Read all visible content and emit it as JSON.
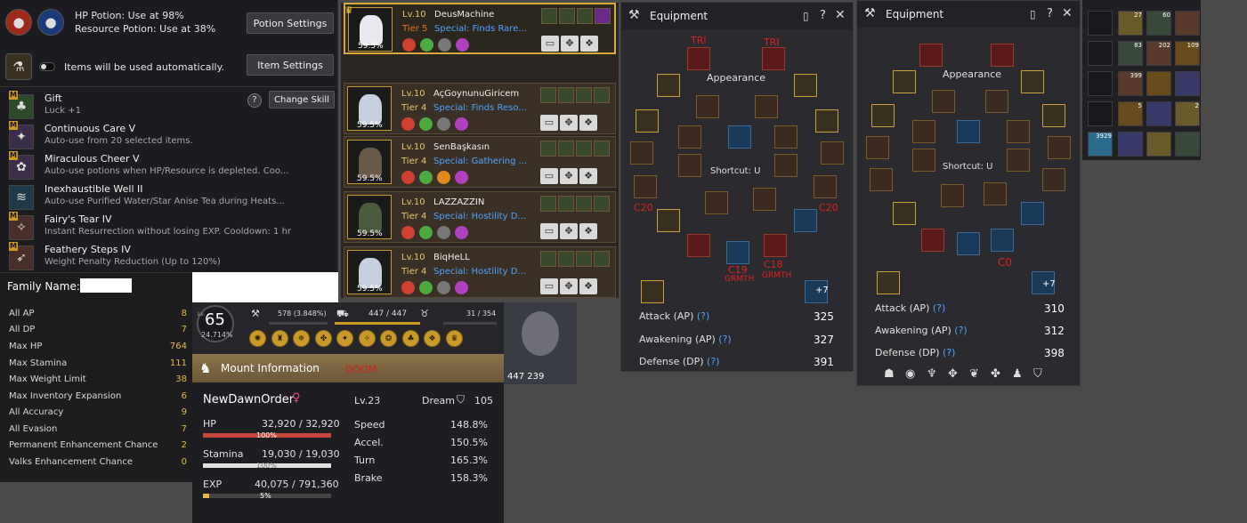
{
  "potions": {
    "hp_text": "HP Potion: Use at 98%",
    "resource_text": "Resource Potion: Use at 38%",
    "potion_settings": "Potion Settings",
    "auto_text": "Items will be used automatically.",
    "item_settings": "Item Settings",
    "change_skill": "Change Skill",
    "help": "?"
  },
  "skills": [
    {
      "name": "Gift",
      "desc": "Luck +1",
      "icon": "clover-icon"
    },
    {
      "name": "Continuous Care V",
      "desc": "Auto-use from 20 selected items.",
      "icon": "care-icon"
    },
    {
      "name": "Miraculous Cheer V",
      "desc": "Auto-use potions when HP/Resource is depleted. Coo...",
      "icon": "cheer-icon"
    },
    {
      "name": "Inexhaustible Well II",
      "desc": "Auto-use Purified Water/Star Anise Tea during Heats...",
      "icon": "well-icon"
    },
    {
      "name": "Fairy's Tear IV",
      "desc": "Instant Resurrection without losing EXP. Cooldown: 1 hr",
      "icon": "tear-icon"
    },
    {
      "name": "Feathery Steps IV",
      "desc": "Weight Penalty Reduction (Up to 120%)",
      "icon": "feather-icon"
    }
  ],
  "family": {
    "title": "Family Name:",
    "stats": [
      {
        "label": "All AP",
        "value": "8"
      },
      {
        "label": "All DP",
        "value": "7"
      },
      {
        "label": "Max HP",
        "value": "764"
      },
      {
        "label": "Max Stamina",
        "value": "111"
      },
      {
        "label": "Max Weight Limit",
        "value": "38"
      },
      {
        "label": "Max Inventory Expansion",
        "value": "6"
      },
      {
        "label": "All Accuracy",
        "value": "9"
      },
      {
        "label": "All Evasion",
        "value": "7"
      },
      {
        "label": "Permanent Enhancement Chance",
        "value": "2"
      },
      {
        "label": "Valks Enhancement Chance",
        "value": "0"
      }
    ]
  },
  "level": {
    "lv_label": "Lv.",
    "level": "65",
    "percent": "24.714%",
    "energy": "578 (3.848%)",
    "weight": "447 / 447",
    "contribution": "31 / 354",
    "silver": "447 239"
  },
  "mount": {
    "title": "Mount Information",
    "doom": "DOOM",
    "name": "NewDawnOrder",
    "level": "Lv.23",
    "dream": "Dream",
    "dream_val": "105",
    "hp_label": "HP",
    "hp_val": "32,920 / 32,920",
    "hp_pct": "100%",
    "hp_fill": 100,
    "st_label": "Stamina",
    "st_val": "19,030 / 19,030",
    "st_pct": "100%",
    "st_fill": 100,
    "exp_label": "EXP",
    "exp_val": "40,075 / 791,360",
    "exp_pct": "5%",
    "exp_fill": 5,
    "speed_l": "Speed",
    "speed": "148.8%",
    "accel_l": "Accel.",
    "accel": "150.5%",
    "turn_l": "Turn",
    "turn": "165.3%",
    "brake_l": "Brake",
    "brake": "158.3%"
  },
  "pets": [
    {
      "lv": "Lv.10",
      "name": "DeusMachine",
      "tier": "Tier 5",
      "tier_color": "#e8702a",
      "spec": "Special: Finds Rare...",
      "pct": "59.5%"
    },
    {
      "lv": "Lv.10",
      "name": "AçGoynunuGiricem",
      "tier": "Tier 4",
      "tier_color": "#e8c66a",
      "spec": "Special: Finds Reso...",
      "pct": "59.5%"
    },
    {
      "lv": "Lv.10",
      "name": "SenBaşkasın",
      "tier": "Tier 4",
      "tier_color": "#e8c66a",
      "spec": "Special: Gathering ...",
      "pct": "59.5%"
    },
    {
      "lv": "Lv.10",
      "name": "LAZZAZZIN",
      "tier": "Tier 4",
      "tier_color": "#e8c66a",
      "spec": "Special: Hostility D...",
      "pct": "59.5%"
    },
    {
      "lv": "Lv.10",
      "name": "BiqHeLL",
      "tier": "Tier 4",
      "tier_color": "#e8c66a",
      "spec": "Special: Hostility D...",
      "pct": "59.5%"
    }
  ],
  "equip1": {
    "title": "Equipment",
    "appearance": "Appearance",
    "shortcut": "Shortcut: U",
    "labels": [
      "TRI",
      "TRI",
      "C20",
      "C20",
      "C19",
      "GRMTH",
      "C18",
      "GRMTH"
    ],
    "plus": "+7",
    "attack_l": "Attack (AP)",
    "attack": "325",
    "awak_l": "Awakening (AP)",
    "awak": "327",
    "def_l": "Defense (DP)",
    "def": "391",
    "q": "(?)"
  },
  "equip2": {
    "title": "Equipment",
    "appearance": "Appearance",
    "shortcut": "Shortcut: U",
    "c0": "C0",
    "plus": "+7",
    "attack_l": "Attack (AP)",
    "attack": "310",
    "awak_l": "Awakening (AP)",
    "awak": "312",
    "def_l": "Defense (DP)",
    "def": "398",
    "q": "(?)"
  },
  "inventory": {
    "counts": [
      "27",
      "60",
      "",
      "",
      "83",
      "202",
      "109",
      "",
      "399",
      "",
      "",
      "",
      "5",
      "",
      "2",
      "3929",
      "",
      "",
      ""
    ]
  },
  "colors": {
    "gold": "#c99a28",
    "hp_bar": "#c8473a",
    "stamina_bar": "#e0e0e0",
    "exp_bar": "#e8b846",
    "red_label": "#e02020",
    "link_blue": "#4da3ff"
  }
}
